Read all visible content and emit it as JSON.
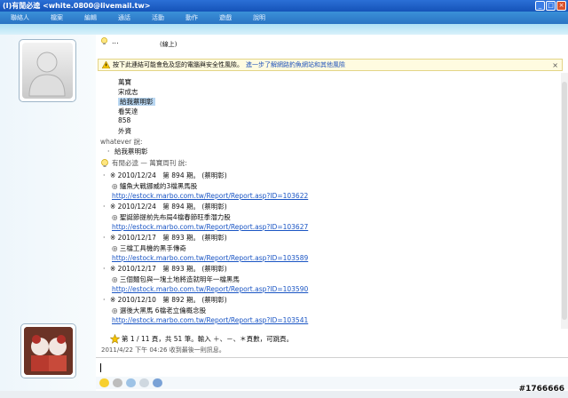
{
  "window": {
    "title": "(I)有閒必逵 <white.0800@livemail.tw>"
  },
  "menu": [
    "聯絡人",
    "檔案",
    "編輯",
    "通話",
    "活動",
    "動作",
    "遊戲",
    "說明"
  ],
  "contact": {
    "name": "...",
    "status": "(線上)"
  },
  "warning": {
    "text": "按下此連結可能會危及您的電腦與安全性風險。",
    "link": "進一步了解網路釣魚網站和其他風險",
    "close": "×"
  },
  "messages_top": [
    "萬寶",
    "宋成志",
    "給我蔡明彰",
    "看笑達",
    "858",
    "外資"
  ],
  "whatever": {
    "sender": "whatever 說:",
    "msg": "給我蔡明彰"
  },
  "bot": {
    "sender": "有閒必逵 — 萬寶周刊 說:"
  },
  "reports": [
    {
      "date": "※ 2010/12/24　第 894 期。 (蔡明彰)",
      "title": "◎ 鱸魚大戰挪威的3檔黑馬股",
      "url": "http://estock.marbo.com.tw/Report/Report.asp?ID=103622"
    },
    {
      "date": "※ 2010/12/24　第 894 期。 (蔡明彰)",
      "title": "◎ 聖誕節提前先布局4檔春節旺季潛力股",
      "url": "http://estock.marbo.com.tw/Report/Report.asp?ID=103627"
    },
    {
      "date": "※ 2010/12/17　第 893 期。 (蔡明彰)",
      "title": "◎ 三檔工具機的黑手傳奇",
      "url": "http://estock.marbo.com.tw/Report/Report.asp?ID=103589"
    },
    {
      "date": "※ 2010/12/17　第 893 期。 (蔡明彰)",
      "title": "◎ 三個麵包與一塊土地將造就明年一檔黑馬",
      "url": "http://estock.marbo.com.tw/Report/Report.asp?ID=103590"
    },
    {
      "date": "※ 2010/12/10　第 892 期。 (蔡明彰)",
      "title": "◎ 選後大黑馬 6檔老立倫概念股",
      "url": "http://estock.marbo.com.tw/Report/Report.asp?ID=103541"
    }
  ],
  "page_info": "第 1 / 11 頁，共 51 筆。輸入 ＋、－、＊頁數，可跳頁。",
  "last_msg": "2011/4/22 下午 04:26 收到最後一則訊息。",
  "watermark": "#1766666",
  "colors": {
    "titlebar": "#1553b8",
    "link": "#1a55c4",
    "selection": "#b9d7f2"
  }
}
